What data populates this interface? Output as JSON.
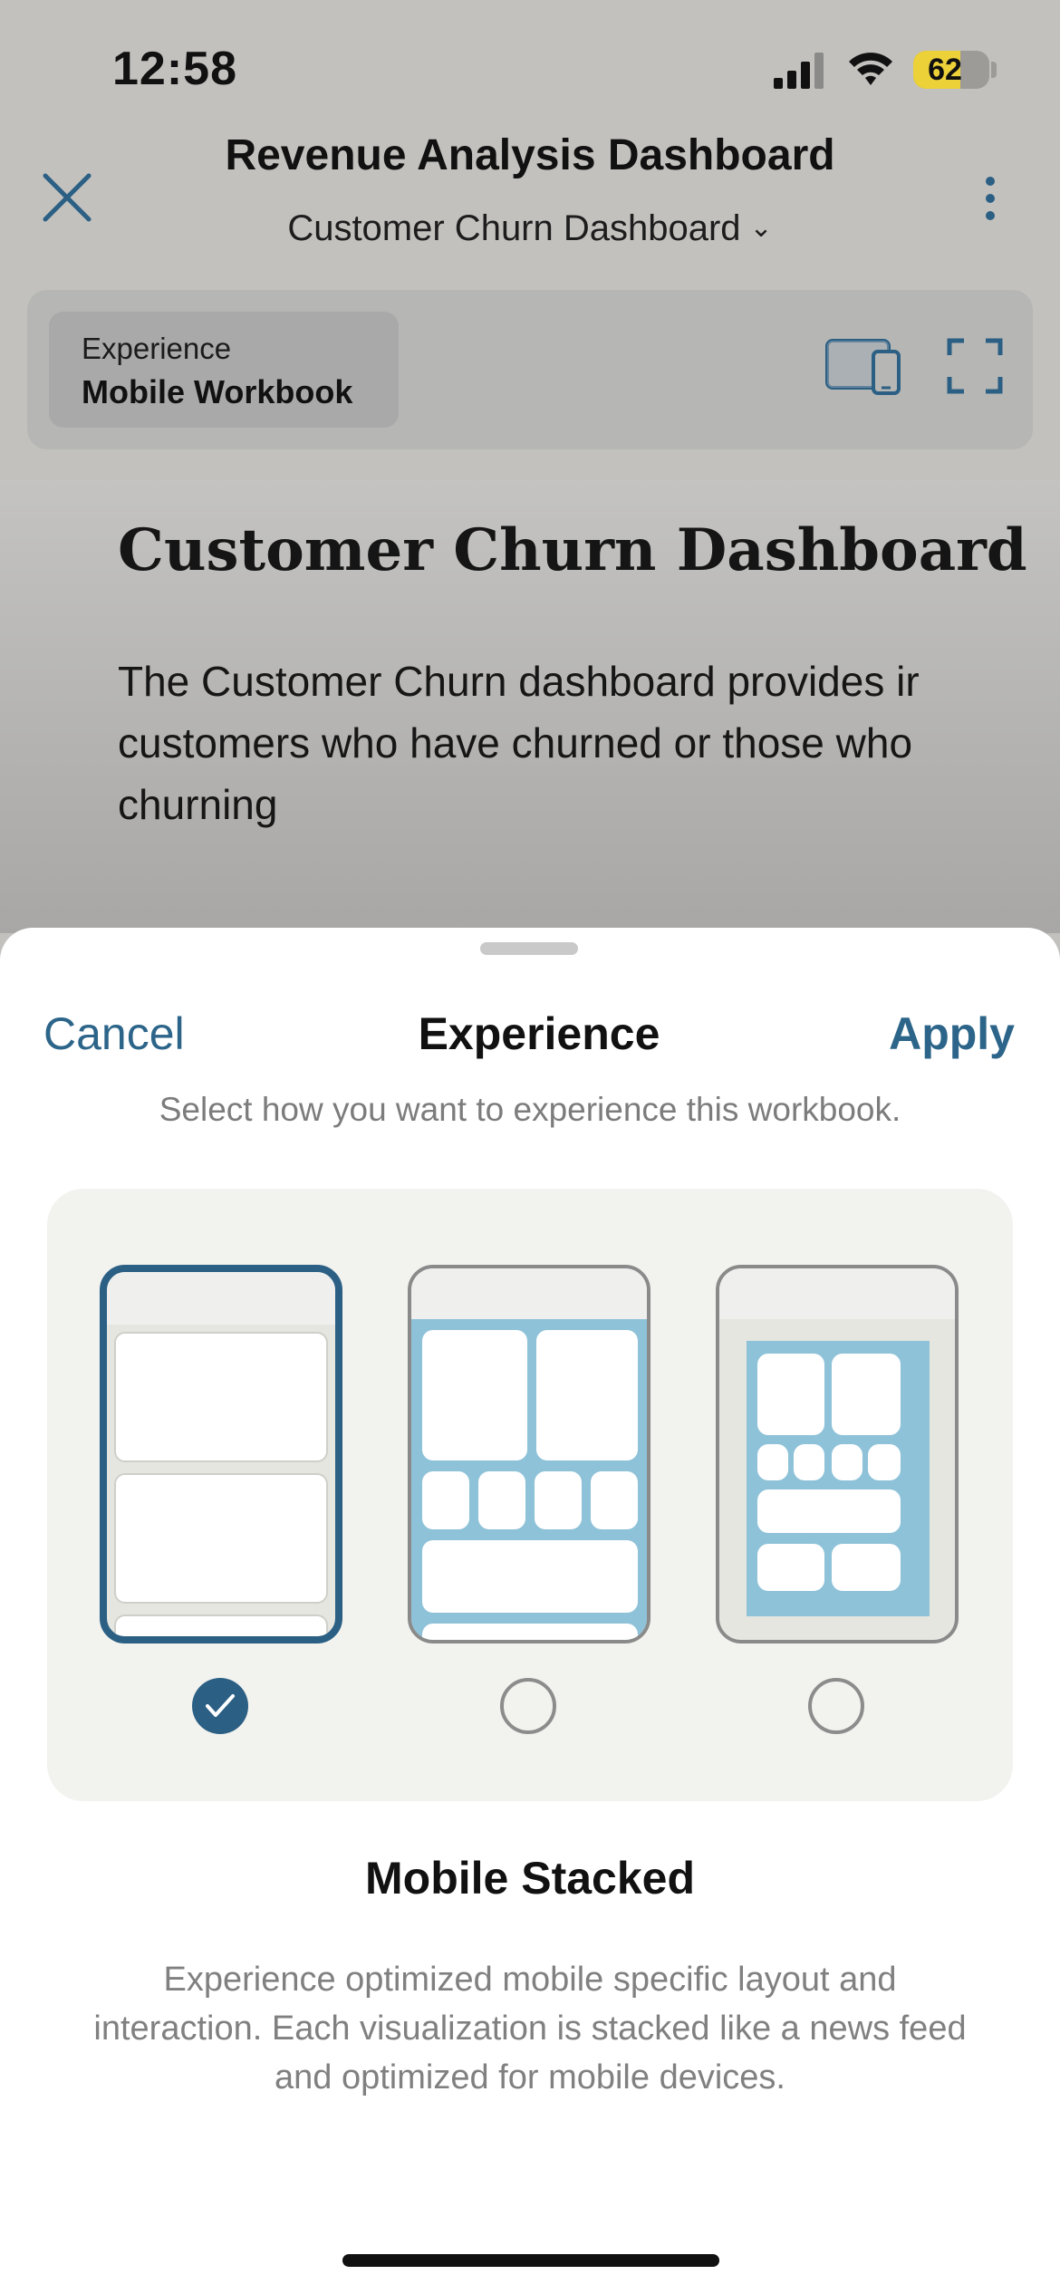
{
  "status_bar": {
    "time": "12:58",
    "battery": "62",
    "battery_level": 0.62,
    "colors": {
      "battery_fill": "#ecd139"
    }
  },
  "header": {
    "title": "Revenue Analysis Dashboard",
    "subtitle": "Customer Churn Dashboard",
    "subtitle_icon": "chevron-down-icon",
    "close_icon": "close-icon",
    "more_icon": "more-vertical-icon"
  },
  "toolbar": {
    "experience_label": "Experience",
    "experience_value": "Mobile Workbook",
    "device_icon": "device-toggle-icon",
    "fullscreen_icon": "fullscreen-icon"
  },
  "content": {
    "title": "Customer Churn Dashboard",
    "body_lines": [
      "The Customer Churn dashboard provides ir",
      "customers who have churned or those who",
      "churning"
    ]
  },
  "sheet": {
    "cancel": "Cancel",
    "title": "Experience",
    "apply": "Apply",
    "subtitle": "Select how you want to experience this workbook.",
    "options": [
      {
        "id": "mobile-stacked",
        "selected": true
      },
      {
        "id": "tablet-layout",
        "selected": false
      },
      {
        "id": "desktop-layout",
        "selected": false
      }
    ],
    "selected_title": "Mobile Stacked",
    "selected_description": "Experience optimized mobile specific layout and interaction. Each visualization is stacked like a news feed and optimized for mobile devices."
  },
  "colors": {
    "accent": "#2c6589",
    "selected_border": "#2b5f84",
    "layout_blue": "#8ec2d8"
  }
}
